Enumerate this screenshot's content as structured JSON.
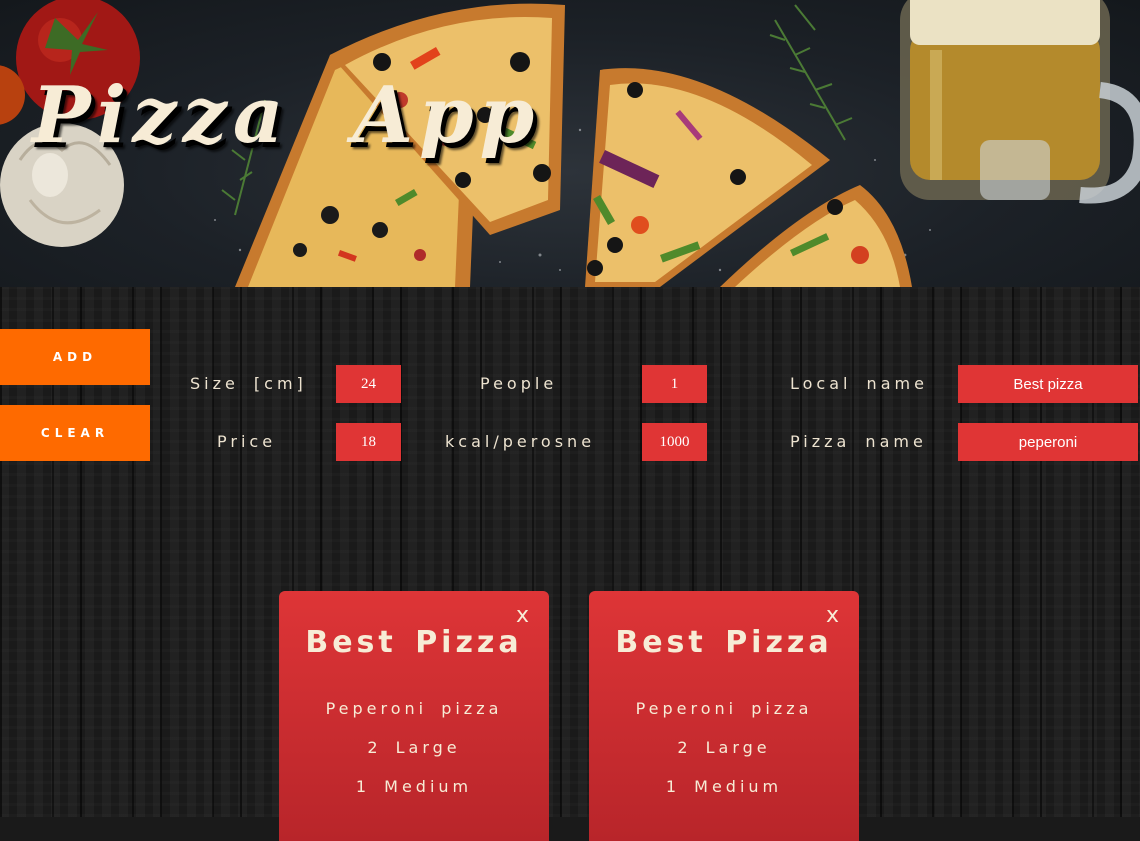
{
  "header": {
    "title": "Pizza App"
  },
  "actions": {
    "add_label": "ADD",
    "clear_label": "CLEAR"
  },
  "form": {
    "size": {
      "label": "Size [cm]",
      "value": "24"
    },
    "price": {
      "label": "Price",
      "value": "18"
    },
    "people": {
      "label": "People",
      "value": "1"
    },
    "kcal": {
      "label": "kcal/perosne",
      "value": "1000"
    },
    "local_name": {
      "label": "Local name",
      "value": "Best pizza"
    },
    "pizza_name": {
      "label": "Pizza name",
      "value": "peperoni"
    }
  },
  "cards": [
    {
      "close": "x",
      "title": "Best Pizza",
      "pizza": "Peperoni pizza",
      "large": "2 Large",
      "medium": "1 Medium"
    },
    {
      "close": "x",
      "title": "Best Pizza",
      "pizza": "Peperoni pizza",
      "large": "2 Large",
      "medium": "1 Medium"
    }
  ],
  "colors": {
    "accent_orange": "#fe6a00",
    "input_red": "#e03535",
    "card_red": "#de3537",
    "cream": "#f7ecd6"
  }
}
